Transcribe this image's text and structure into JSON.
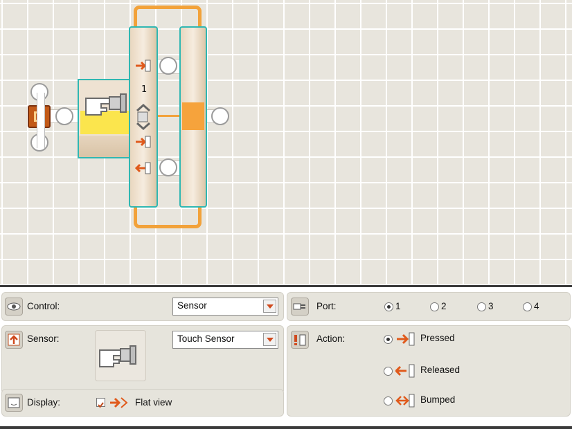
{
  "canvas": {
    "loop_count_label": "1"
  },
  "panel": {
    "control": {
      "label": "Control:",
      "value": "Sensor"
    },
    "sensor": {
      "label": "Sensor:",
      "value": "Touch Sensor"
    },
    "display": {
      "label": "Display:",
      "checkbox_checked": true,
      "flat_view_label": "Flat view"
    },
    "port": {
      "label": "Port:",
      "options": [
        "1",
        "2",
        "3",
        "4"
      ],
      "selected": "1"
    },
    "action": {
      "label": "Action:",
      "options": [
        "Pressed",
        "Released",
        "Bumped"
      ],
      "selected": "Pressed"
    }
  },
  "colors": {
    "accent_orange": "#f2a23a",
    "selection_teal": "#2fb7b2",
    "yellow": "#ffe94a"
  },
  "icons": [
    "eye-icon",
    "sensor-up-icon",
    "display-icon",
    "plug-icon",
    "action-icon",
    "touch-sensor-icon",
    "flat-view-icon",
    "pressed-icon",
    "released-icon",
    "bumped-icon"
  ]
}
